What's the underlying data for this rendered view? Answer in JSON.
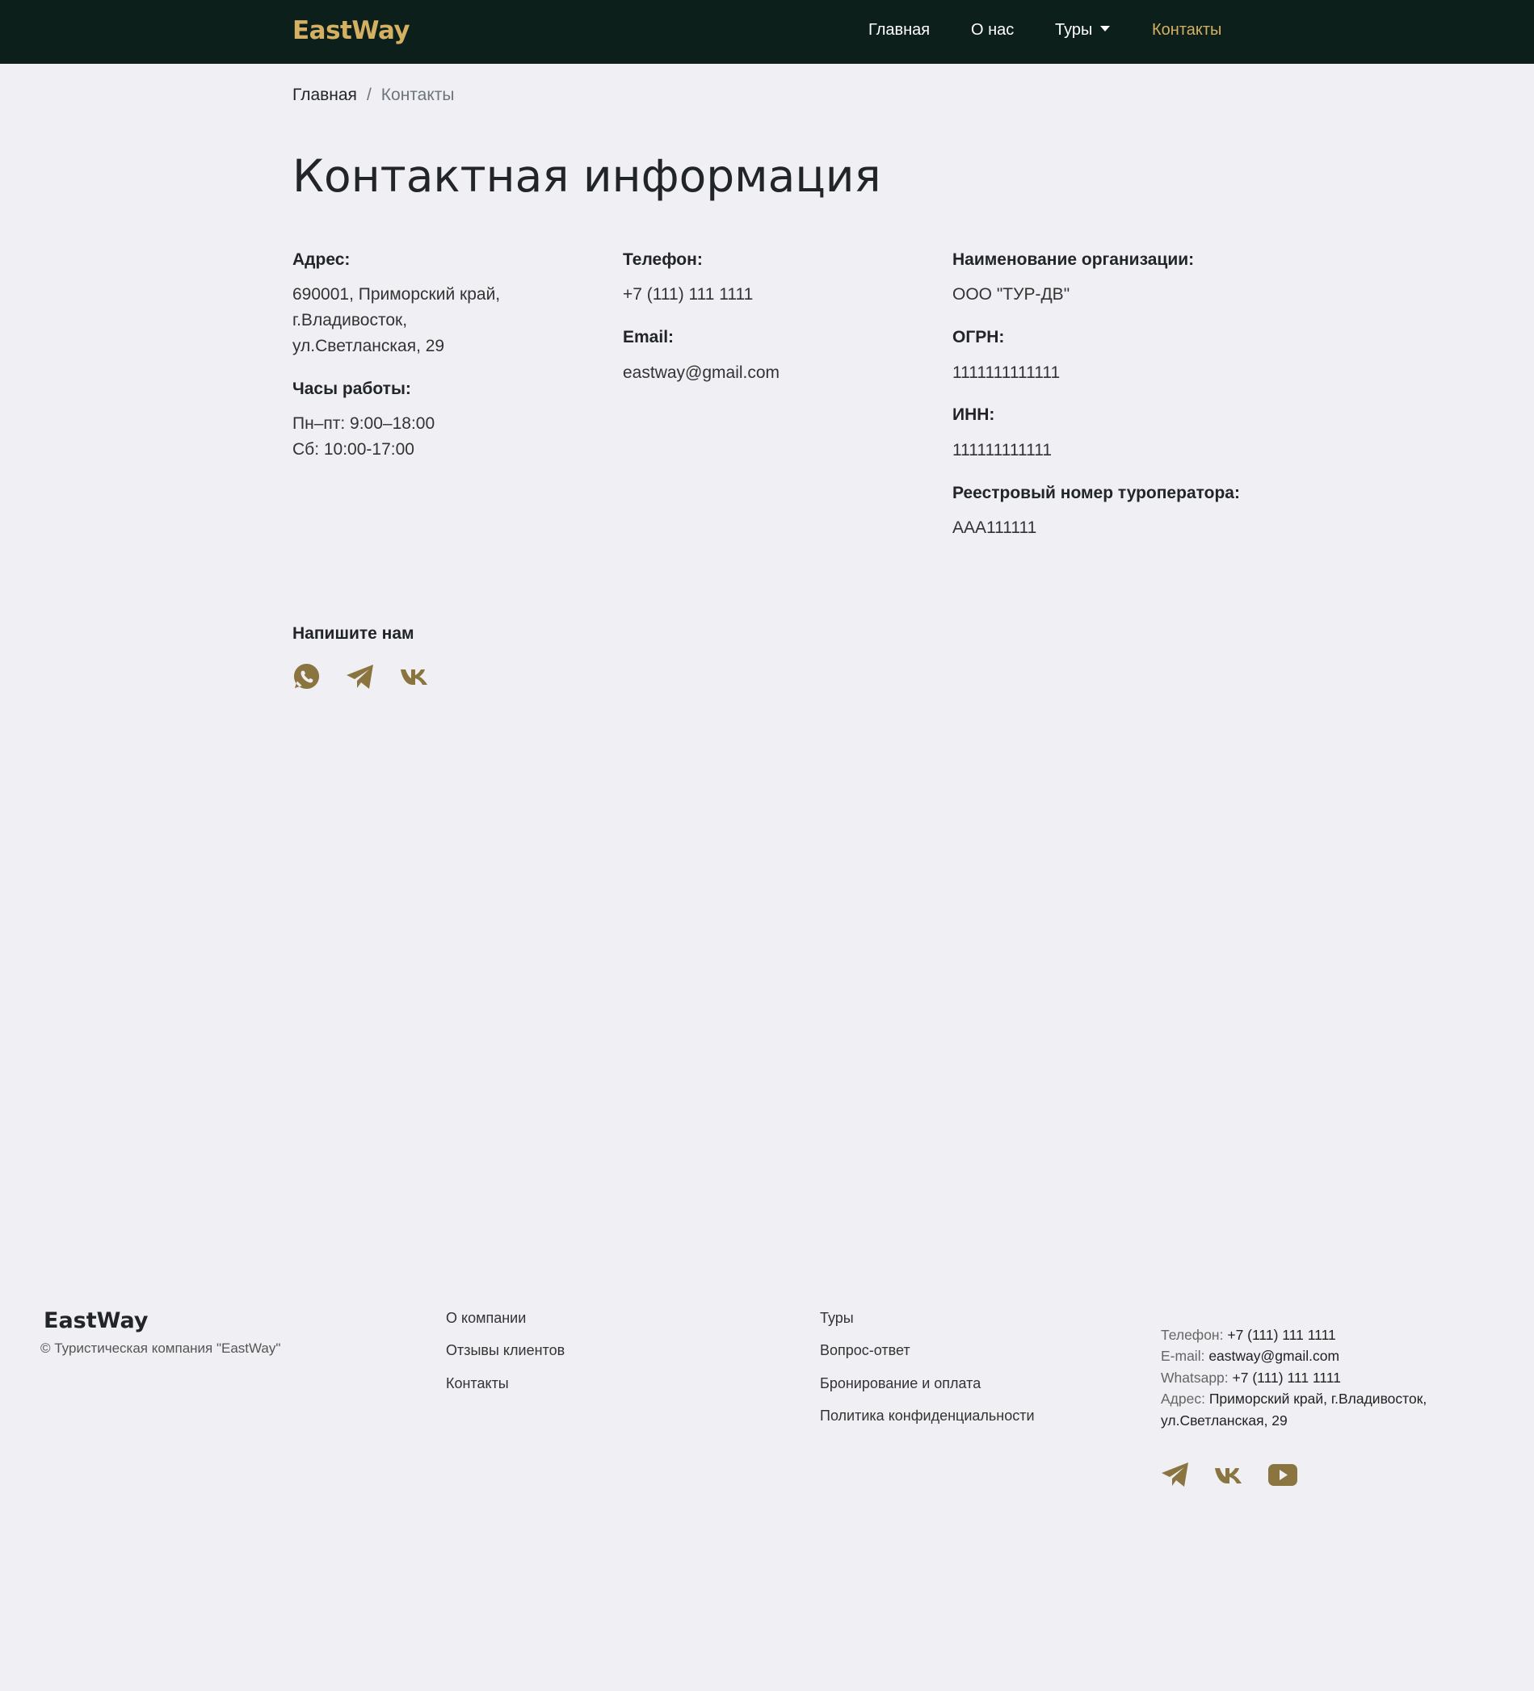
{
  "header": {
    "logo": "EastWay",
    "nav": [
      {
        "label": "Главная"
      },
      {
        "label": "О нас"
      },
      {
        "label": "Туры"
      },
      {
        "label": "Контакты"
      }
    ]
  },
  "breadcrumb": {
    "home": "Главная",
    "separator": "/",
    "current": "Контакты"
  },
  "title": "Контактная информация",
  "contacts": {
    "address_label": "Адрес:",
    "address_lines": [
      "690001, Приморский край,",
      "г.Владивосток,",
      "ул.Светланская, 29"
    ],
    "hours_label": "Часы работы:",
    "hours_lines": [
      "Пн–пт: 9:00–18:00",
      "Сб: 10:00-17:00"
    ],
    "phone_label": "Телефон:",
    "phone": "+7 (111) 111 1111",
    "email_label": "Email:",
    "email": "eastway@gmail.com",
    "org_label": "Наименование организации:",
    "org": "ООО \"ТУР-ДВ\"",
    "ogrn_label": "ОГРН:",
    "ogrn": "1111111111111",
    "inn_label": "ИНН:",
    "inn": "111111111111",
    "registry_label": "Реестровый номер туроператора:",
    "registry": "ААА111111"
  },
  "write_us": {
    "label": "Напишите нам",
    "icons": [
      "whatsapp-icon",
      "telegram-icon",
      "vk-icon"
    ]
  },
  "footer": {
    "logo": "EastWay",
    "copyright": "© Туристическая компания \"EastWay\"",
    "col1": [
      "О компании",
      "Отзывы клиентов",
      "Контакты"
    ],
    "col2": [
      "Туры",
      "Вопрос-ответ",
      "Бронирование и оплата",
      "Политика конфиденциальности"
    ],
    "phone_key": "Телефон:",
    "phone_val": "+7 (111) 111 1111",
    "email_key": "E-mail:",
    "email_val": "eastway@gmail.com",
    "whatsapp_key": "Whatsapp:",
    "whatsapp_val": "+7 (111) 111 1111",
    "address_key": "Адрес:",
    "address_val1": "Приморский край, г.Владивосток,",
    "address_val2": "ул.Светланская, 29",
    "icons": [
      "telegram-icon",
      "vk-icon",
      "youtube-icon"
    ]
  },
  "colors": {
    "accent": "#d4b062",
    "icon": "#8a7440",
    "navbar": "#0d1f1a",
    "background": "#f0f0f4"
  }
}
